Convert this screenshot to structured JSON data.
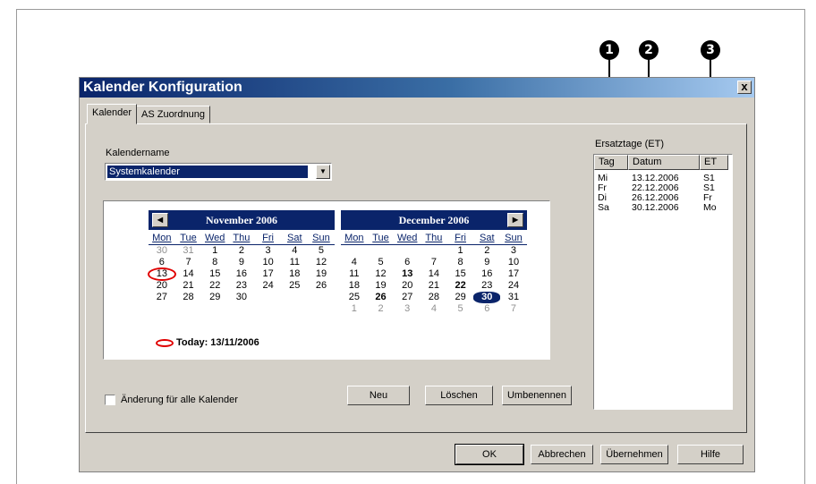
{
  "dialog": {
    "title": "Kalender Konfiguration",
    "close_label": "x"
  },
  "tabs": [
    {
      "label": "Kalender",
      "active": true
    },
    {
      "label": "AS Zuordnung",
      "active": false
    }
  ],
  "calendar_name": {
    "label": "Kalendername",
    "value": "Systemkalender"
  },
  "weekdays": [
    "Mon",
    "Tue",
    "Wed",
    "Thu",
    "Fri",
    "Sat",
    "Sun"
  ],
  "months": [
    {
      "title": "November 2006",
      "weeks": [
        [
          {
            "d": "30",
            "o": true
          },
          {
            "d": "31",
            "o": true
          },
          {
            "d": "1"
          },
          {
            "d": "2"
          },
          {
            "d": "3"
          },
          {
            "d": "4"
          },
          {
            "d": "5"
          }
        ],
        [
          {
            "d": "6"
          },
          {
            "d": "7"
          },
          {
            "d": "8"
          },
          {
            "d": "9"
          },
          {
            "d": "10"
          },
          {
            "d": "11"
          },
          {
            "d": "12"
          }
        ],
        [
          {
            "d": "13",
            "t": true
          },
          {
            "d": "14"
          },
          {
            "d": "15"
          },
          {
            "d": "16"
          },
          {
            "d": "17"
          },
          {
            "d": "18"
          },
          {
            "d": "19"
          }
        ],
        [
          {
            "d": "20"
          },
          {
            "d": "21"
          },
          {
            "d": "22"
          },
          {
            "d": "23"
          },
          {
            "d": "24"
          },
          {
            "d": "25"
          },
          {
            "d": "26"
          }
        ],
        [
          {
            "d": "27"
          },
          {
            "d": "28"
          },
          {
            "d": "29"
          },
          {
            "d": "30"
          },
          {
            "d": ""
          },
          {
            "d": ""
          },
          {
            "d": ""
          }
        ]
      ]
    },
    {
      "title": "December 2006",
      "weeks": [
        [
          {
            "d": ""
          },
          {
            "d": ""
          },
          {
            "d": ""
          },
          {
            "d": ""
          },
          {
            "d": "1"
          },
          {
            "d": "2"
          },
          {
            "d": "3"
          }
        ],
        [
          {
            "d": "4"
          },
          {
            "d": "5"
          },
          {
            "d": "6"
          },
          {
            "d": "7"
          },
          {
            "d": "8"
          },
          {
            "d": "9"
          },
          {
            "d": "10"
          }
        ],
        [
          {
            "d": "11"
          },
          {
            "d": "12"
          },
          {
            "d": "13",
            "b": true
          },
          {
            "d": "14"
          },
          {
            "d": "15"
          },
          {
            "d": "16"
          },
          {
            "d": "17"
          }
        ],
        [
          {
            "d": "18"
          },
          {
            "d": "19"
          },
          {
            "d": "20"
          },
          {
            "d": "21"
          },
          {
            "d": "22",
            "b": true
          },
          {
            "d": "23"
          },
          {
            "d": "24"
          }
        ],
        [
          {
            "d": "25"
          },
          {
            "d": "26",
            "b": true
          },
          {
            "d": "27"
          },
          {
            "d": "28"
          },
          {
            "d": "29"
          },
          {
            "d": "30",
            "s": true
          },
          {
            "d": "31"
          }
        ],
        [
          {
            "d": "1",
            "o": true
          },
          {
            "d": "2",
            "o": true
          },
          {
            "d": "3",
            "o": true
          },
          {
            "d": "4",
            "o": true
          },
          {
            "d": "5",
            "o": true
          },
          {
            "d": "6",
            "o": true
          },
          {
            "d": "7",
            "o": true
          }
        ]
      ]
    }
  ],
  "today_text": "Today: 13/11/2006",
  "et": {
    "label": "Ersatztage (ET)",
    "columns": [
      "Tag",
      "Datum",
      "ET"
    ],
    "rows": [
      [
        "Mi",
        "13.12.2006",
        "S1"
      ],
      [
        "Fr",
        "22.12.2006",
        "S1"
      ],
      [
        "Di",
        "26.12.2006",
        "Fr"
      ],
      [
        "Sa",
        "30.12.2006",
        "Mo"
      ]
    ]
  },
  "all_calendars_label": "Änderung für alle Kalender",
  "panel_buttons": {
    "new": "Neu",
    "delete": "Löschen",
    "rename": "Umbenennen"
  },
  "footer_buttons": {
    "ok": "OK",
    "cancel": "Abbrechen",
    "apply": "Übernehmen",
    "help": "Hilfe"
  },
  "callouts": [
    "1",
    "2",
    "3"
  ],
  "colors": {
    "title_start": "#0a246a",
    "title_end": "#a6caf0",
    "selection": "#0a246a",
    "today_mark": "#e00000",
    "dialog_bg": "#d4d0c8"
  }
}
